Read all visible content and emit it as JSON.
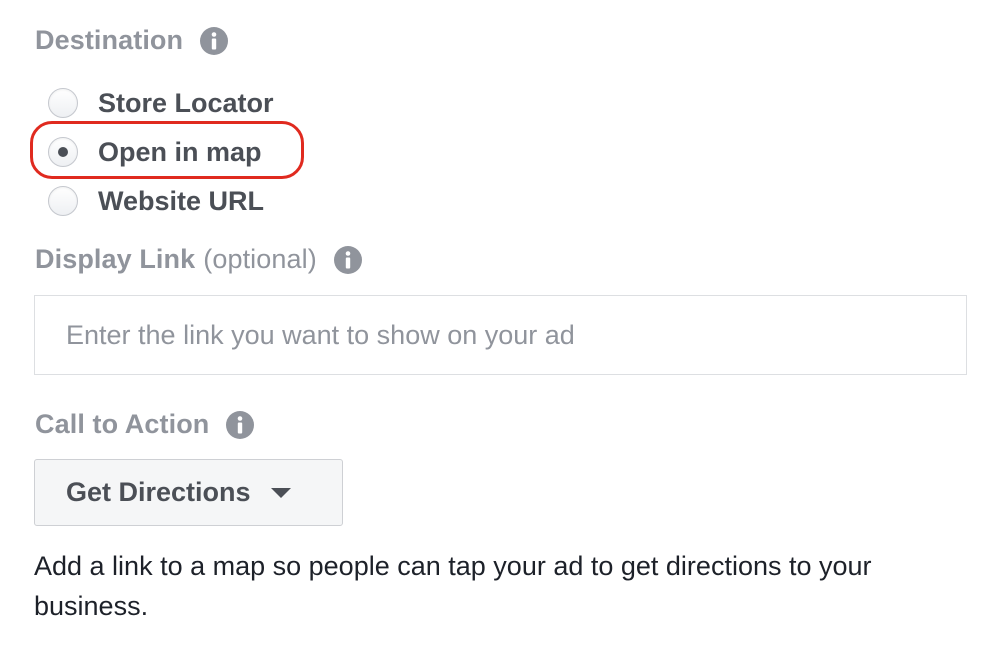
{
  "destination": {
    "label": "Destination",
    "info_icon": "info-icon",
    "options": [
      {
        "label": "Store Locator",
        "selected": false
      },
      {
        "label": "Open in map",
        "selected": true
      },
      {
        "label": "Website URL",
        "selected": false
      }
    ],
    "highlight_color": "#e02a1f"
  },
  "display_link": {
    "label": "Display Link",
    "optional_text": "(optional)",
    "info_icon": "info-icon",
    "value": "",
    "placeholder": "Enter the link you want to show on your ad"
  },
  "call_to_action": {
    "label": "Call to Action",
    "info_icon": "info-icon",
    "selected_value": "Get Directions",
    "dropdown_icon": "caret-down-icon"
  },
  "helper_text": "Add a link to a map so people can tap your ad to get directions to your business.",
  "colors": {
    "label_gray": "#90949c",
    "text_dark": "#4b4f56",
    "body_text": "#1d2129",
    "input_border": "#dddfe2",
    "button_bg": "#f5f6f7"
  }
}
